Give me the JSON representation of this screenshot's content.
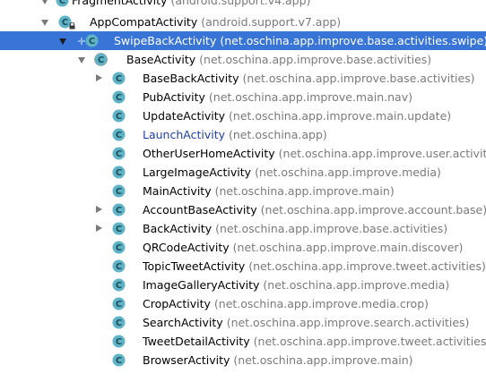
{
  "hierarchy": {
    "nodes": [
      {
        "name": "FragmentActivity",
        "package": "(android.support.v4.app)",
        "expanded": true,
        "depth": 0
      },
      {
        "name": "AppCompatActivity",
        "package": "(android.support.v7.app)",
        "expanded": true,
        "depth": 1
      },
      {
        "name": "SwipeBackActivity",
        "package": "(net.oschina.app.improve.base.activities.swipe)",
        "expanded": true,
        "depth": 2,
        "selected": true
      },
      {
        "name": "BaseActivity",
        "package": "(net.oschina.app.improve.base.activities)",
        "expanded": true,
        "depth": 3
      },
      {
        "name": "BaseBackActivity",
        "package": "(net.oschina.app.improve.base.activities)",
        "expandable": true,
        "depth": 4
      },
      {
        "name": "PubActivity",
        "package": "(net.oschina.app.improve.main.nav)",
        "depth": 4
      },
      {
        "name": "UpdateActivity",
        "package": "(net.oschina.app.improve.main.update)",
        "depth": 4
      },
      {
        "name": "LaunchActivity",
        "package": "(net.oschina.app)",
        "depth": 4,
        "link": true
      },
      {
        "name": "OtherUserHomeActivity",
        "package": "(net.oschina.app.improve.user.activities)",
        "depth": 4
      },
      {
        "name": "LargeImageActivity",
        "package": "(net.oschina.app.improve.media)",
        "depth": 4
      },
      {
        "name": "MainActivity",
        "package": "(net.oschina.app.improve.main)",
        "depth": 4
      },
      {
        "name": "AccountBaseActivity",
        "package": "(net.oschina.app.improve.account.base)",
        "expandable": true,
        "depth": 4
      },
      {
        "name": "BackActivity",
        "package": "(net.oschina.app.improve.base.activities)",
        "expandable": true,
        "depth": 4
      },
      {
        "name": "QRCodeActivity",
        "package": "(net.oschina.app.improve.main.discover)",
        "depth": 4
      },
      {
        "name": "TopicTweetActivity",
        "package": "(net.oschina.app.improve.tweet.activities)",
        "depth": 4
      },
      {
        "name": "ImageGalleryActivity",
        "package": "(net.oschina.app.improve.media)",
        "depth": 4
      },
      {
        "name": "CropActivity",
        "package": "(net.oschina.app.improve.media.crop)",
        "depth": 4
      },
      {
        "name": "SearchActivity",
        "package": "(net.oschina.app.improve.search.activities)",
        "depth": 4
      },
      {
        "name": "TweetDetailActivity",
        "package": "(net.oschina.app.improve.tweet.activities)",
        "depth": 4
      },
      {
        "name": "BrowserActivity",
        "package": "(net.oschina.app.improve.main)",
        "depth": 4
      }
    ]
  },
  "colors": {
    "selection": "#3875d7",
    "class_icon": "#5fb3c6",
    "package_text": "#7a7a7a",
    "link_text": "#1f3fa8"
  },
  "icons": {
    "class": "class-icon",
    "abstract_class": "abstract-class-icon",
    "lock": "lock-icon",
    "expand": "chevron-down-icon",
    "collapse": "chevron-right-icon"
  }
}
